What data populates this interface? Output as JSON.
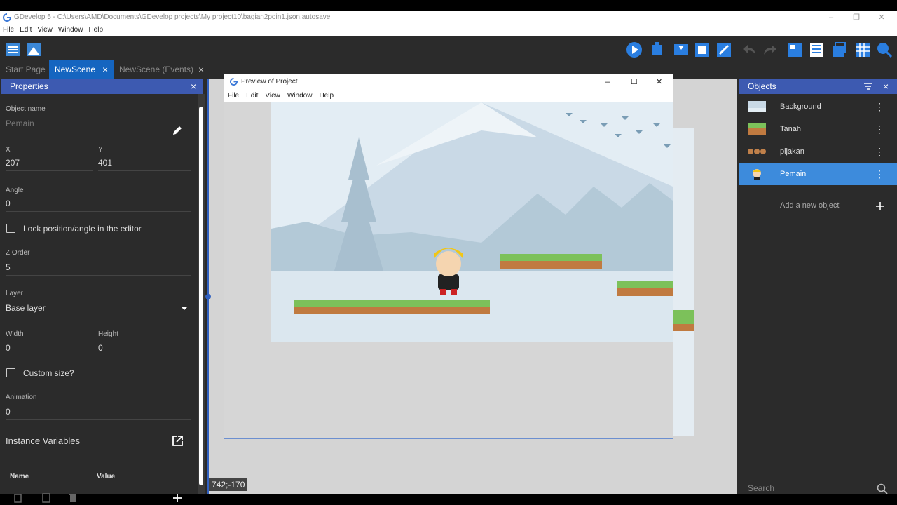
{
  "window": {
    "title": "GDevelop 5 - C:\\Users\\AMD\\Documents\\GDevelop projects\\My project10\\bagian2poin1.json.autosave",
    "minimize": "–",
    "restore": "❐",
    "close": "✕"
  },
  "menubar": [
    "File",
    "Edit",
    "View",
    "Window",
    "Help"
  ],
  "tabs": [
    {
      "label": "Start Page"
    },
    {
      "label": "NewScene"
    },
    {
      "label": "NewScene (Events)"
    }
  ],
  "tab_close": "×",
  "properties": {
    "title": "Properties",
    "close": "×",
    "object_name_label": "Object name",
    "object_name": "Pemain",
    "x_label": "X",
    "x": "207",
    "y_label": "Y",
    "y": "401",
    "angle_label": "Angle",
    "angle": "0",
    "lock_label": "Lock position/angle in the editor",
    "zorder_label": "Z Order",
    "zorder": "5",
    "layer_label": "Layer",
    "layer": "Base layer",
    "width_label": "Width",
    "width": "0",
    "height_label": "Height",
    "height": "0",
    "custom_size_label": "Custom size?",
    "animation_label": "Animation",
    "animation": "0",
    "instance_variables": "Instance Variables",
    "col_name": "Name",
    "col_value": "Value"
  },
  "scene": {
    "coordinates": "742;-170"
  },
  "preview": {
    "title": "Preview of Project",
    "menu": [
      "File",
      "Edit",
      "View",
      "Window",
      "Help"
    ],
    "minimize": "–",
    "maximize": "☐",
    "close": "✕"
  },
  "objects": {
    "title": "Objects",
    "items": [
      {
        "name": "Background"
      },
      {
        "name": "Tanah"
      },
      {
        "name": "pijakan"
      },
      {
        "name": "Pemain"
      }
    ],
    "add_label": "Add a new object",
    "search_placeholder": "Search"
  },
  "colors": {
    "accent": "#3d5ab1",
    "selected": "#3d8bdc",
    "panel": "#2b2b2b"
  }
}
